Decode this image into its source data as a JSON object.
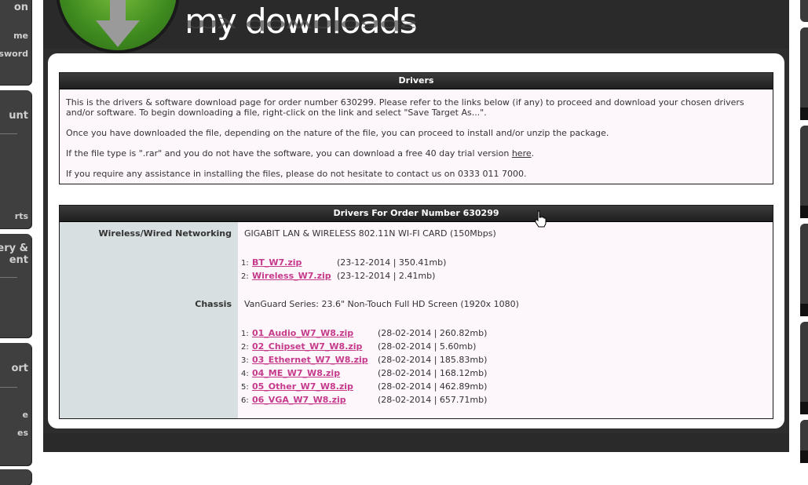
{
  "sidebar": {
    "cards": [
      {
        "lines": [
          "on"
        ],
        "small": [
          "me",
          "sword"
        ]
      },
      {
        "lines": [
          "unt"
        ],
        "small": [
          "rts"
        ]
      },
      {
        "lines": [
          "ery &",
          "ent"
        ],
        "small": []
      },
      {
        "lines": [
          "ort"
        ],
        "small": [
          "e",
          "es"
        ]
      }
    ]
  },
  "header": {
    "title": "my downloads"
  },
  "drivers_box": {
    "heading": "Drivers",
    "para1": "This is the drivers & software download page for order number 630299. Please refer to the links below (if any) to proceed and download your chosen drivers and/or software. To begin downloading a file, right-click on the link and select \"Save Target As...\".",
    "para2": "Once you have downloaded the file, depending on the nature of the file, you can proceed to install and/or unzip the package.",
    "para3_before": "If the file type is \".rar\" and you do not have the software, you can download a free 40 day trial version ",
    "para3_link": "here",
    "para3_after": ".",
    "para4": "If you require any assistance in installing the files, please do not hesitate to contact us on 0333 011 7000."
  },
  "order_box": {
    "heading": "Drivers For Order Number 630299",
    "sections": [
      {
        "category": "Wireless/Wired Networking",
        "description": "GIGABIT LAN & WIRELESS 802.11N WI-FI CARD (150Mbps)",
        "files": [
          {
            "num": "1:",
            "name": "BT_W7.zip",
            "meta": "(23-12-2014 | 350.41mb)"
          },
          {
            "num": "2:",
            "name": "Wireless_W7.zip",
            "meta": "(23-12-2014 | 2.41mb)"
          }
        ]
      },
      {
        "category": "Chassis",
        "description": "VanGuard Series: 23.6\" Non-Touch Full HD Screen (1920x 1080)",
        "files": [
          {
            "num": "1:",
            "name": "01_Audio_W7_W8.zip",
            "meta": "(28-02-2014 | 260.82mb)"
          },
          {
            "num": "2:",
            "name": "02_Chipset_W7_W8.zip",
            "meta": "(28-02-2014 | 5.60mb)"
          },
          {
            "num": "3:",
            "name": "03_Ethernet_W7_W8.zip",
            "meta": "(28-02-2014 | 185.83mb)"
          },
          {
            "num": "4:",
            "name": "04_ME_W7_W8.zip",
            "meta": "(28-02-2014 | 168.12mb)"
          },
          {
            "num": "5:",
            "name": "05_Other_W7_W8.zip",
            "meta": "(28-02-2014 | 462.89mb)"
          },
          {
            "num": "6:",
            "name": "06_VGA_W7_W8.zip",
            "meta": "(28-02-2014 | 657.71mb)"
          }
        ]
      }
    ]
  },
  "colors": {
    "link": "#c63a8c",
    "panel": "#2e2e2e",
    "box_bg": "#fdf6fb",
    "category_bg": "#d7dfe0"
  },
  "icons": {
    "logo": "download-arrow-icon",
    "cursor": "hand-cursor-icon"
  }
}
